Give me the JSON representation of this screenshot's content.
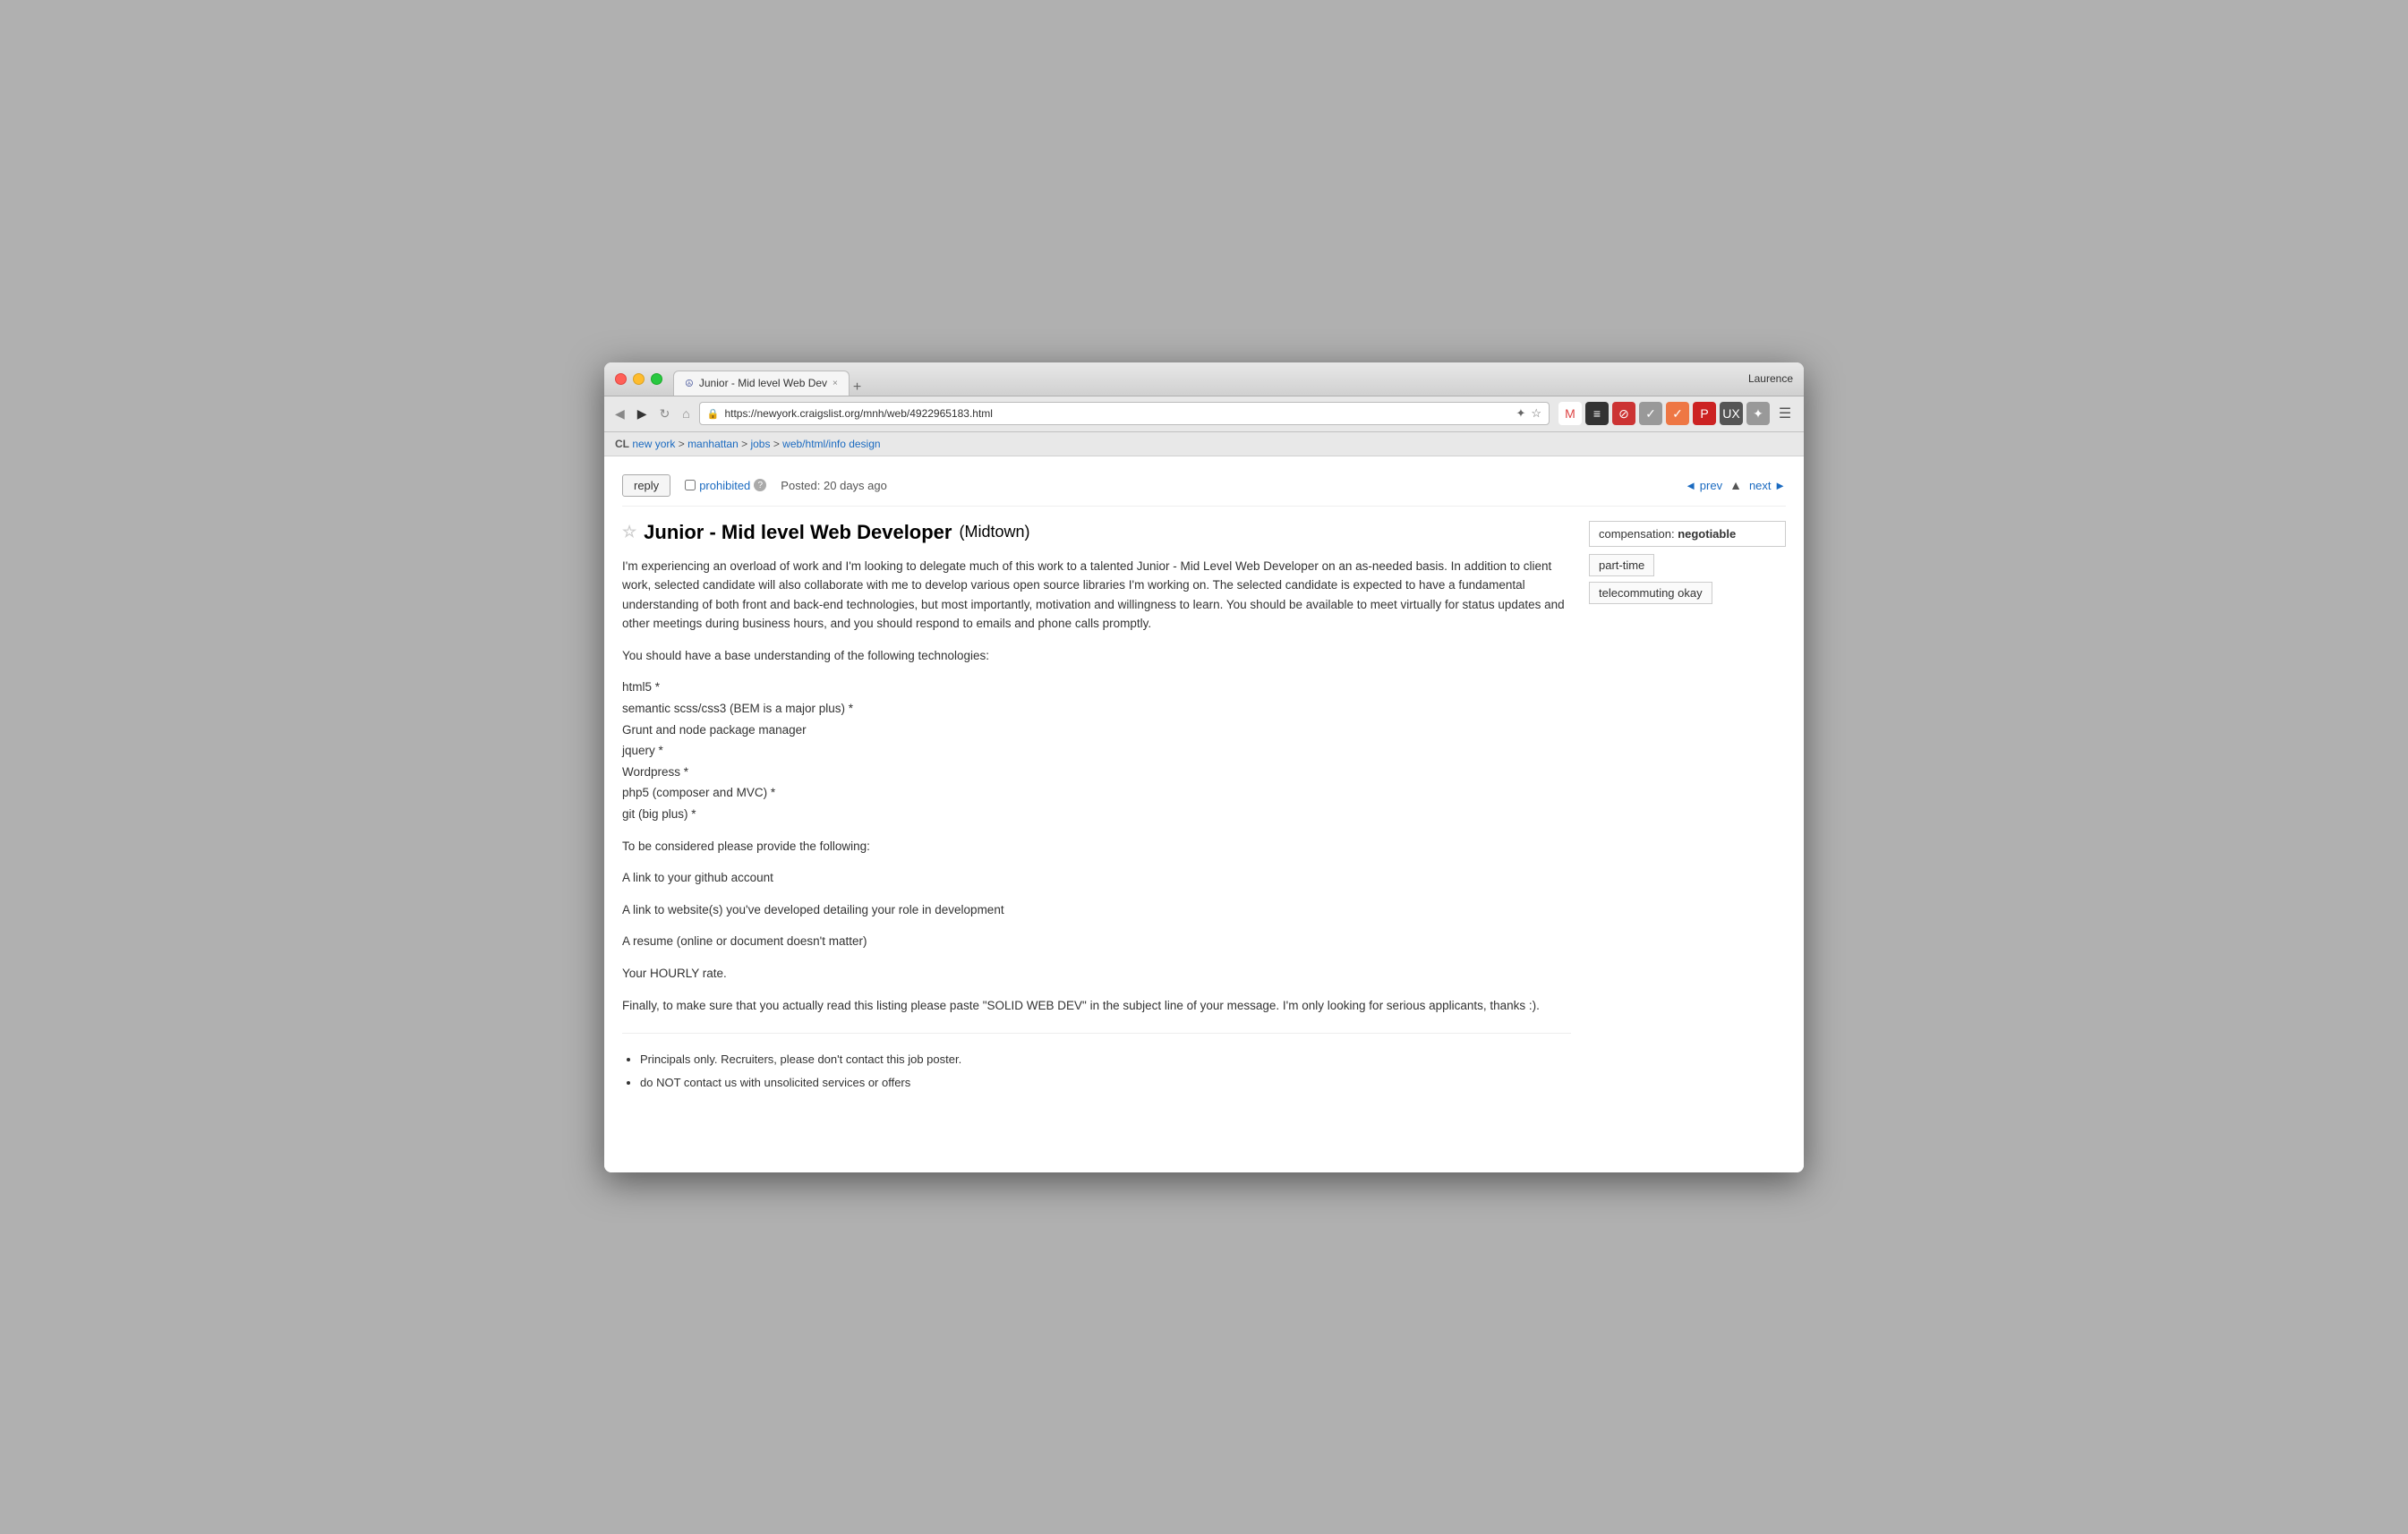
{
  "browser": {
    "user": "Laurence",
    "tab": {
      "favicon": "☮",
      "title": "Junior - Mid level Web Dev",
      "close": "×"
    },
    "new_tab": "+",
    "url": "https://newyork.craigslist.org/mnh/web/4922965183.html",
    "nav": {
      "back": "◀",
      "forward": "▶",
      "refresh": "↻",
      "home": "⌂"
    },
    "address_icons": {
      "rss": "✦",
      "star": "☆"
    },
    "toolbar_icons": [
      {
        "name": "gmail",
        "label": "M",
        "class": "ti-gmail"
      },
      {
        "name": "layers",
        "label": "≡",
        "class": "ti-layers"
      },
      {
        "name": "shield",
        "label": "⊘",
        "class": "ti-shield"
      },
      {
        "name": "checkmark",
        "label": "✓",
        "class": "ti-check"
      },
      {
        "name": "feather",
        "label": "✓",
        "class": "ti-feather"
      },
      {
        "name": "pinterest",
        "label": "P",
        "class": "ti-pinterest"
      },
      {
        "name": "ux",
        "label": "UX",
        "class": "ti-ux"
      },
      {
        "name": "extension",
        "label": "✦",
        "class": "ti-ext"
      }
    ]
  },
  "breadcrumb": {
    "cl": "CL",
    "new_york": "new york",
    "manhattan": "manhattan",
    "jobs": "jobs",
    "category": "web/html/info design"
  },
  "post_nav": {
    "reply_label": "reply",
    "prohibited_label": "prohibited",
    "prohibited_num": "?",
    "posted_label": "Posted:",
    "posted_date": "20 days ago",
    "prev_label": "◄ prev",
    "next_label": "next ►",
    "up_label": "▲"
  },
  "post": {
    "star": "☆",
    "title": "Junior - Mid level Web Developer",
    "location": "(Midtown)",
    "body_para1": "I'm experiencing an overload of work and I'm looking to delegate much of this work to a talented Junior - Mid Level Web Developer on an as-needed basis. In addition to client work, selected candidate will also collaborate with me to develop various open source libraries I'm working on. The selected candidate is expected to have a fundamental understanding of both front and back-end technologies, but most importantly, motivation and willingness to learn. You should be available to meet virtually for status updates and other meetings during business hours, and you should respond to emails and phone calls promptly.",
    "tech_intro": "You should have a base understanding of the following technologies:",
    "tech_list": [
      "html5 *",
      "semantic scss/css3 (BEM is a major plus) *",
      "Grunt and node package manager",
      "jquery *",
      "Wordpress *",
      "php5 (composer and MVC) *",
      "git (big plus) *"
    ],
    "consider_label": "To be considered please provide the following:",
    "requirements": [
      "A link to your github account",
      "A link to website(s) you've developed detailing your role in development",
      "A resume (online or document doesn't matter)",
      "Your HOURLY rate."
    ],
    "final_note": "Finally, to make sure that you actually read this listing please paste \"SOLID WEB DEV\" in the subject line of your message. I'm only looking for serious applicants, thanks :).",
    "footer_items": [
      "Principals only. Recruiters, please don't contact this job poster.",
      "do NOT contact us with unsolicited services or offers"
    ]
  },
  "sidebar": {
    "compensation_label": "compensation:",
    "compensation_value": "negotiable",
    "tag1": "part-time",
    "tag2": "telecommuting okay"
  }
}
